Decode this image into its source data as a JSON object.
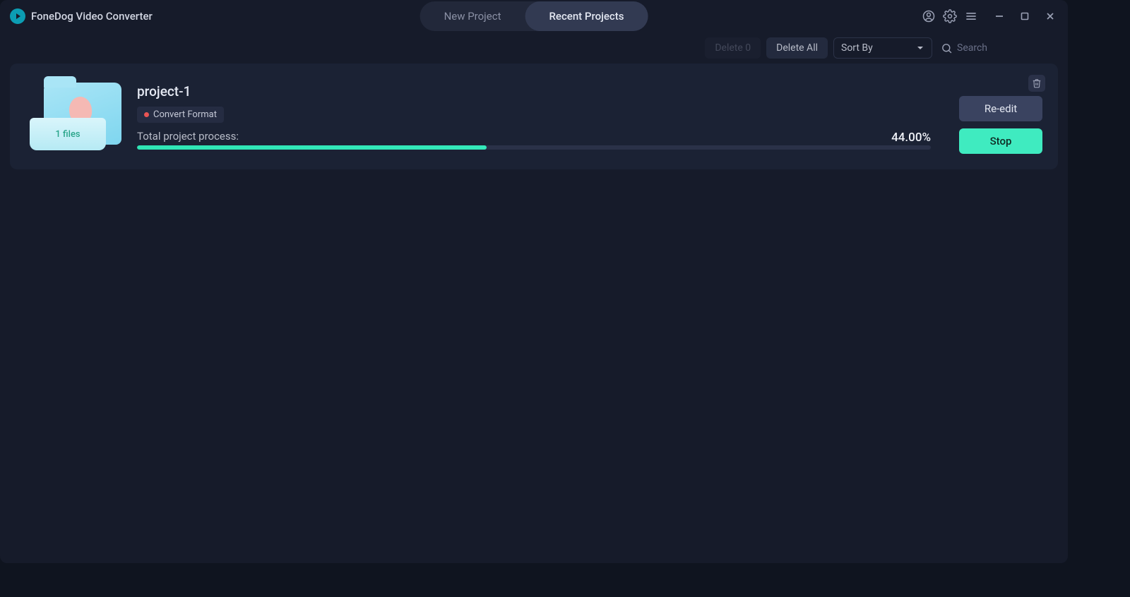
{
  "app": {
    "title": "FoneDog Video Converter"
  },
  "tabs": {
    "new_project": "New Project",
    "recent_projects": "Recent Projects"
  },
  "toolbar": {
    "delete_label": "Delete 0",
    "delete_all_label": "Delete All",
    "sort_by_label": "Sort By",
    "search_placeholder": "Search"
  },
  "project": {
    "name": "project-1",
    "tag_label": "Convert Format",
    "files_label": "1 files",
    "progress_label": "Total project process:",
    "progress_percent": "44.00%",
    "progress_value": 44
  },
  "actions": {
    "reedit": "Re-edit",
    "stop": "Stop"
  }
}
